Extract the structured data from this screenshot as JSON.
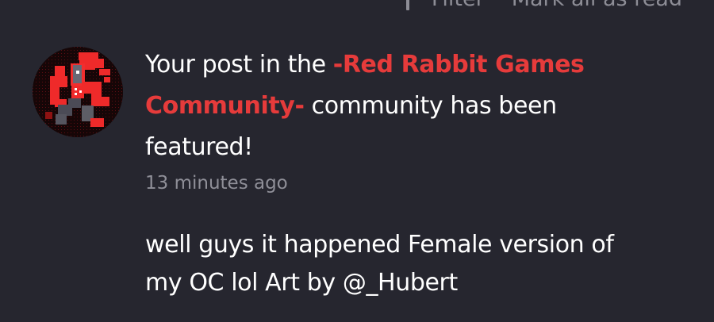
{
  "toolbar": {
    "filter_label": "Filter",
    "mark_all_label": "Mark all as read"
  },
  "notification": {
    "message_prefix": "Your post in the ",
    "community_name": "-Red Rabbit Games Community-",
    "message_suffix": " community has been featured!",
    "timestamp": "13 minutes ago",
    "post_excerpt": "well guys it happened Female version of my OC lol Art by @_Hubert",
    "avatar_icon": "pixel-art-character-icon"
  },
  "colors": {
    "background": "#26262f",
    "accent": "#e63b3b",
    "muted_text": "#8f8f98",
    "primary_text": "#ffffff"
  }
}
